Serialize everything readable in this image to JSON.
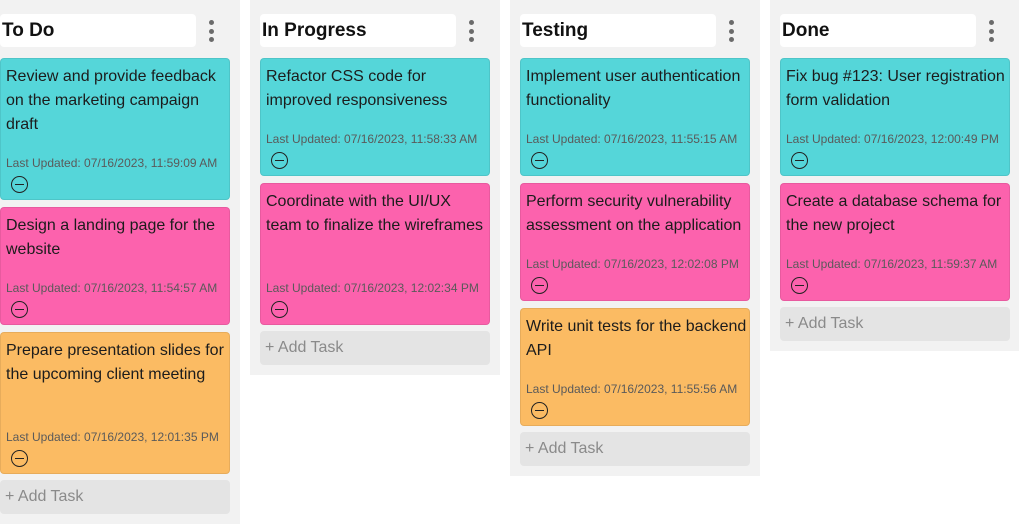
{
  "colors": {
    "cyan": "#55d6d9",
    "pink": "#fc62ad",
    "orange": "#fbbb63"
  },
  "columns": [
    {
      "title": "To Do",
      "add_task": "+ Add Task",
      "cards": [
        {
          "text": "Review and provide feedback on the marketing campaign draft",
          "updated": "Last Updated: 07/16/2023, 11:59:09 AM",
          "color": "cyan"
        },
        {
          "text": "Design a landing page for the website",
          "updated": "Last Updated: 07/16/2023, 11:54:57 AM",
          "color": "pink"
        },
        {
          "text": "Prepare presentation slides for the upcoming client meeting",
          "updated": "Last Updated: 07/16/2023, 12:01:35 PM",
          "color": "orange"
        }
      ]
    },
    {
      "title": "In Progress",
      "add_task": "+ Add Task",
      "cards": [
        {
          "text": "Refactor CSS code for improved responsiveness",
          "updated": "Last Updated: 07/16/2023, 11:58:33 AM",
          "color": "cyan"
        },
        {
          "text": "Coordinate with the UI/UX team to finalize the wireframes",
          "updated": "Last Updated: 07/16/2023, 12:02:34 PM",
          "color": "pink"
        }
      ]
    },
    {
      "title": "Testing",
      "add_task": "+ Add Task",
      "cards": [
        {
          "text": "Implement user authentication functionality",
          "updated": "Last Updated: 07/16/2023, 11:55:15 AM",
          "color": "cyan"
        },
        {
          "text": "Perform security vulnerability assessment on the application",
          "updated": "Last Updated: 07/16/2023, 12:02:08 PM",
          "color": "pink"
        },
        {
          "text": "Write unit tests for the backend API",
          "updated": "Last Updated: 07/16/2023, 11:55:56 AM",
          "color": "orange"
        }
      ]
    },
    {
      "title": "Done",
      "add_task": "+ Add Task",
      "cards": [
        {
          "text": "Fix bug #123: User registration form validation",
          "updated": "Last Updated: 07/16/2023, 12:00:49 PM",
          "color": "cyan"
        },
        {
          "text": "Create a database schema for the new project",
          "updated": "Last Updated: 07/16/2023, 11:59:37 AM",
          "color": "pink"
        }
      ]
    }
  ]
}
